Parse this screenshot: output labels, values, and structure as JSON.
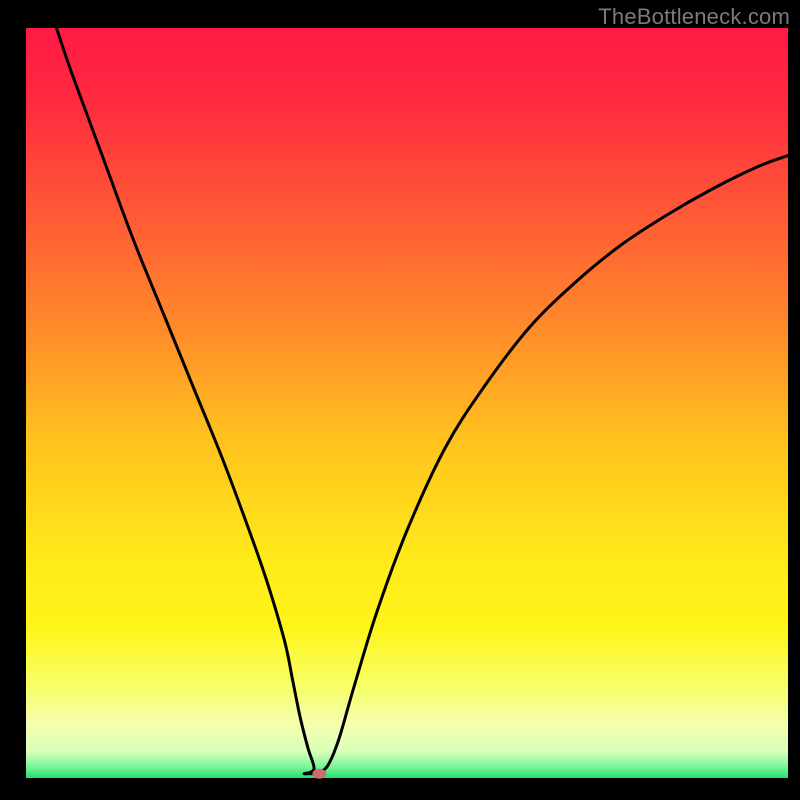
{
  "watermark": "TheBottleneck.com",
  "colors": {
    "frame": "#000000",
    "watermark": "#7a7a7a",
    "curve": "#000000",
    "marker": "#cc6d6c",
    "gradient_stops": [
      {
        "offset": 0.0,
        "color": "#ff1a44"
      },
      {
        "offset": 0.1,
        "color": "#ff2b3f"
      },
      {
        "offset": 0.25,
        "color": "#ff5a36"
      },
      {
        "offset": 0.4,
        "color": "#ff8a2a"
      },
      {
        "offset": 0.55,
        "color": "#ffc21e"
      },
      {
        "offset": 0.7,
        "color": "#ffe81a"
      },
      {
        "offset": 0.8,
        "color": "#fff51a"
      },
      {
        "offset": 0.88,
        "color": "#f7ff6a"
      },
      {
        "offset": 0.93,
        "color": "#f4ffb0"
      },
      {
        "offset": 0.965,
        "color": "#d8ffb8"
      },
      {
        "offset": 0.985,
        "color": "#7af59a"
      },
      {
        "offset": 1.0,
        "color": "#23e06e"
      }
    ]
  },
  "chart_data": {
    "type": "line",
    "title": "",
    "xlabel": "",
    "ylabel": "",
    "xlim": [
      0,
      100
    ],
    "ylim": [
      0,
      100
    ],
    "legend": false,
    "grid": false,
    "series": [
      {
        "name": "bottleneck-curve",
        "x": [
          4,
          6,
          10,
          14,
          18,
          22,
          26,
          30,
          32,
          34,
          35,
          36,
          37,
          37.8,
          38.5,
          39.5,
          41,
          43,
          46,
          50,
          55,
          60,
          66,
          72,
          78,
          84,
          90,
          96,
          100
        ],
        "y": [
          100,
          94,
          83,
          72,
          62,
          52,
          42,
          31,
          25,
          18,
          13,
          8,
          4,
          1.2,
          0.7,
          1.5,
          5,
          12,
          22,
          33,
          44,
          52,
          60,
          66,
          71,
          75,
          78.5,
          81.5,
          83
        ]
      }
    ],
    "marker": {
      "x": 38.5,
      "y": 0.7
    },
    "notch_floor_x_range": [
      36.5,
      38.0
    ],
    "annotations": []
  }
}
